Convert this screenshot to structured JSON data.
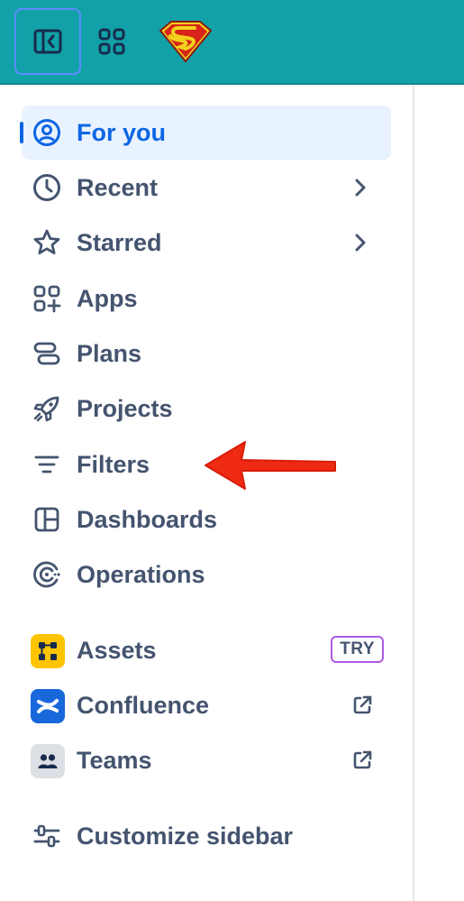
{
  "colors": {
    "topbar": "#12a1a8",
    "accent": "#0c66e4",
    "active_bg": "#e9f2ff",
    "text": "#44546f",
    "try_border": "#af59e1",
    "assets_tile": "#ffc400",
    "confluence_tile": "#1868db",
    "teams_tile": "#dcdfe4",
    "annotation_arrow": "#ee2a12"
  },
  "topbar": {
    "sidebar_toggle_icon": "sidebar-collapse-icon",
    "app_switcher_icon": "app-grid-icon",
    "logo": "superman-logo"
  },
  "nav": {
    "items": [
      {
        "label": "For you",
        "icon": "person-circle-icon",
        "active": true
      },
      {
        "label": "Recent",
        "icon": "clock-icon",
        "chevron": true
      },
      {
        "label": "Starred",
        "icon": "star-icon",
        "chevron": true
      },
      {
        "label": "Apps",
        "icon": "apps-add-icon"
      },
      {
        "label": "Plans",
        "icon": "plans-icon"
      },
      {
        "label": "Projects",
        "icon": "rocket-icon"
      },
      {
        "label": "Filters",
        "icon": "filter-icon"
      },
      {
        "label": "Dashboards",
        "icon": "dashboard-icon"
      },
      {
        "label": "Operations",
        "icon": "operations-icon"
      }
    ],
    "apps": [
      {
        "label": "Assets",
        "icon": "assets-app-icon",
        "badge": "TRY"
      },
      {
        "label": "Confluence",
        "icon": "confluence-app-icon",
        "external": true
      },
      {
        "label": "Teams",
        "icon": "teams-app-icon",
        "external": true
      }
    ],
    "customize": {
      "label": "Customize sidebar",
      "icon": "customize-icon"
    }
  }
}
